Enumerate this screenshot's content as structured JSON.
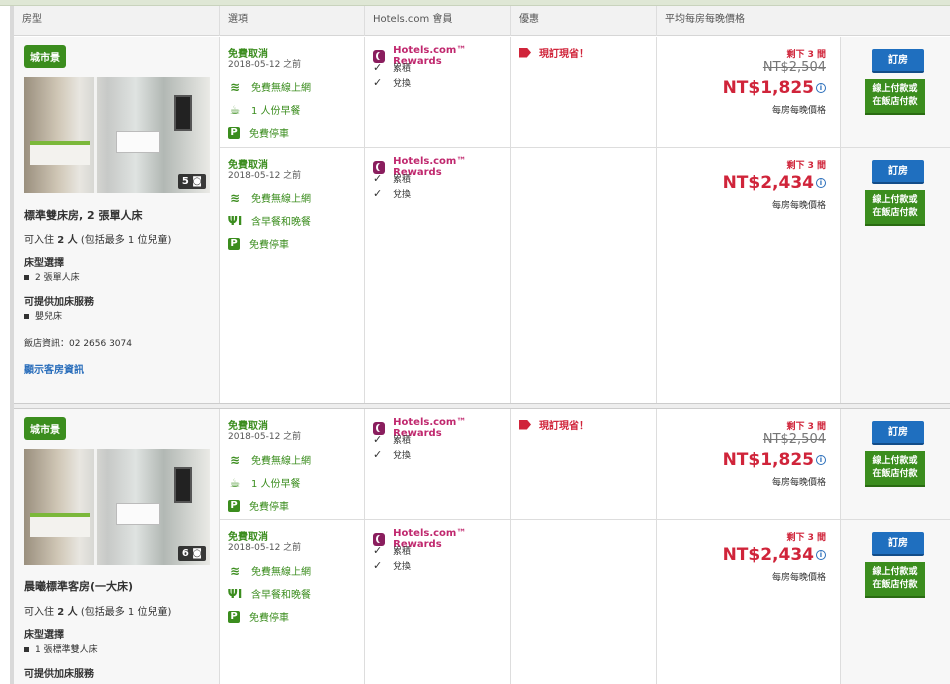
{
  "table_headers": {
    "room_type": "房型",
    "options": "選項",
    "member": "Hotels.com 會員",
    "deal": "優惠",
    "price": "平均每房每晚價格"
  },
  "rooms": [
    {
      "badge": "城市景",
      "photo_count": "5",
      "name": "標準雙床房, 2 張單人床",
      "capacity_prefix": "可入住 ",
      "capacity_num": "2 人",
      "capacity_suffix": " (包括最多 1 位兒童)",
      "bed_heading": "床型選擇",
      "bed_item": "2 張單人床",
      "extra_heading": "可提供加床服務",
      "extra_item": "嬰兒床",
      "phone": "飯店資訊：02 2656 3074",
      "show_link": "顯示客房資訊",
      "rates": [
        {
          "cancel": "免費取消",
          "before": "2018-05-12 之前",
          "amenities": [
            "免費無線上網",
            "1 人份早餐",
            "免費停車"
          ],
          "rewards": "Hotels.com™ Rewards",
          "collect": "累積",
          "redeem": "兌換",
          "deal": "現訂現省！",
          "left": "剩下 3 間",
          "old_price": "NT$2,504",
          "price": "NT$1,825",
          "per_night": "每房每晚價格",
          "book": "訂房",
          "pay1": "線上付款或",
          "pay2": "在飯店付款"
        },
        {
          "cancel": "免費取消",
          "before": "2018-05-12 之前",
          "amenities": [
            "免費無線上網",
            "含早餐和晚餐",
            "免費停車"
          ],
          "rewards": "Hotels.com™ Rewards",
          "collect": "累積",
          "redeem": "兌換",
          "left": "剩下 3 間",
          "price": "NT$2,434",
          "per_night": "每房每晚價格",
          "book": "訂房",
          "pay1": "線上付款或",
          "pay2": "在飯店付款"
        }
      ]
    },
    {
      "badge": "城市景",
      "photo_count": "6",
      "name": "晨曦標準客房(一大床)",
      "capacity_prefix": "可入住 ",
      "capacity_num": "2 人",
      "capacity_suffix": " (包括最多 1 位兒童)",
      "bed_heading": "床型選擇",
      "bed_item": "1 張標準雙人床",
      "extra_heading": "可提供加床服務",
      "rates": [
        {
          "cancel": "免費取消",
          "before": "2018-05-12 之前",
          "amenities": [
            "免費無線上網",
            "1 人份早餐",
            "免費停車"
          ],
          "rewards": "Hotels.com™ Rewards",
          "collect": "累積",
          "redeem": "兌換",
          "deal": "現訂現省！",
          "left": "剩下 3 間",
          "old_price": "NT$2,504",
          "price": "NT$1,825",
          "per_night": "每房每晚價格",
          "book": "訂房",
          "pay1": "線上付款或",
          "pay2": "在飯店付款"
        },
        {
          "cancel": "免費取消",
          "before": "2018-05-12 之前",
          "amenities": [
            "免費無線上網",
            "含早餐和晚餐",
            "免費停車"
          ],
          "rewards": "Hotels.com™ Rewards",
          "collect": "累積",
          "redeem": "兌換",
          "left": "剩下 3 間",
          "price": "NT$2,434",
          "per_night": "每房每晚價格",
          "book": "訂房",
          "pay1": "線上付款或",
          "pay2": "在飯店付款"
        }
      ]
    }
  ],
  "colors": {
    "green": "#3b8d1e",
    "red": "#d0243a",
    "blue": "#1f6fbf",
    "rewards": "#c0286e"
  }
}
